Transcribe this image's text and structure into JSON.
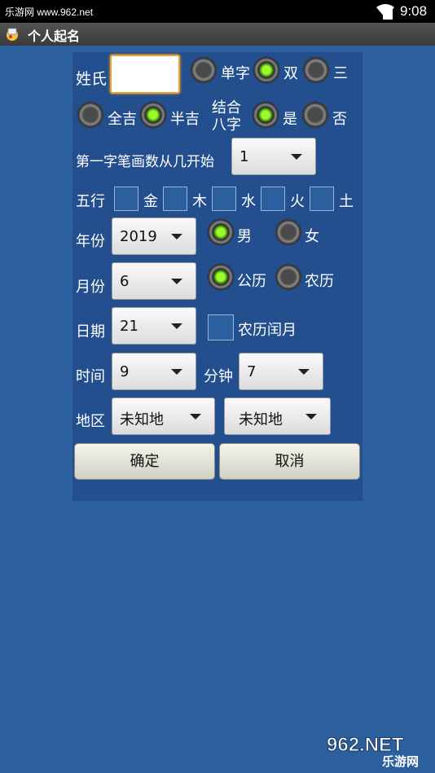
{
  "status": {
    "left_text": "乐游网 www.962.net",
    "time": "9:08"
  },
  "app": {
    "title": "个人起名"
  },
  "form": {
    "surname_label": "姓氏",
    "surname_value": "",
    "name_length": {
      "options": [
        "单字",
        "双",
        "三"
      ],
      "selected": "双"
    },
    "luck": {
      "options": [
        "全吉",
        "半吉"
      ],
      "selected": "半吉"
    },
    "bazi": {
      "label_line1": "结合",
      "label_line2": "八字",
      "options": [
        "是",
        "否"
      ],
      "selected": "是"
    },
    "first_stroke_label": "第一字笔画数从几开始",
    "first_stroke_value": "1",
    "wuxing_label": "五行",
    "wuxing": [
      "金",
      "木",
      "水",
      "火",
      "土"
    ],
    "year_label": "年份",
    "year_value": "2019",
    "gender": {
      "options": [
        "男",
        "女"
      ],
      "selected": "男"
    },
    "month_label": "月份",
    "month_value": "6",
    "calendar": {
      "options": [
        "公历",
        "农历"
      ],
      "selected": "公历"
    },
    "day_label": "日期",
    "day_value": "21",
    "leap_month_label": "农历闰月",
    "hour_label": "时间",
    "hour_value": "9",
    "minute_label": "分钟",
    "minute_value": "7",
    "region_label": "地区",
    "region_value_1": "未知地",
    "region_value_2": "未知地",
    "ok_label": "确定",
    "cancel_label": "取消"
  },
  "watermark": {
    "brand": "962.NET",
    "sub": "乐游网"
  },
  "colors": {
    "background": "#2c5f9e",
    "panel": "#234f8e",
    "radio_on": "#9dfb2b"
  }
}
